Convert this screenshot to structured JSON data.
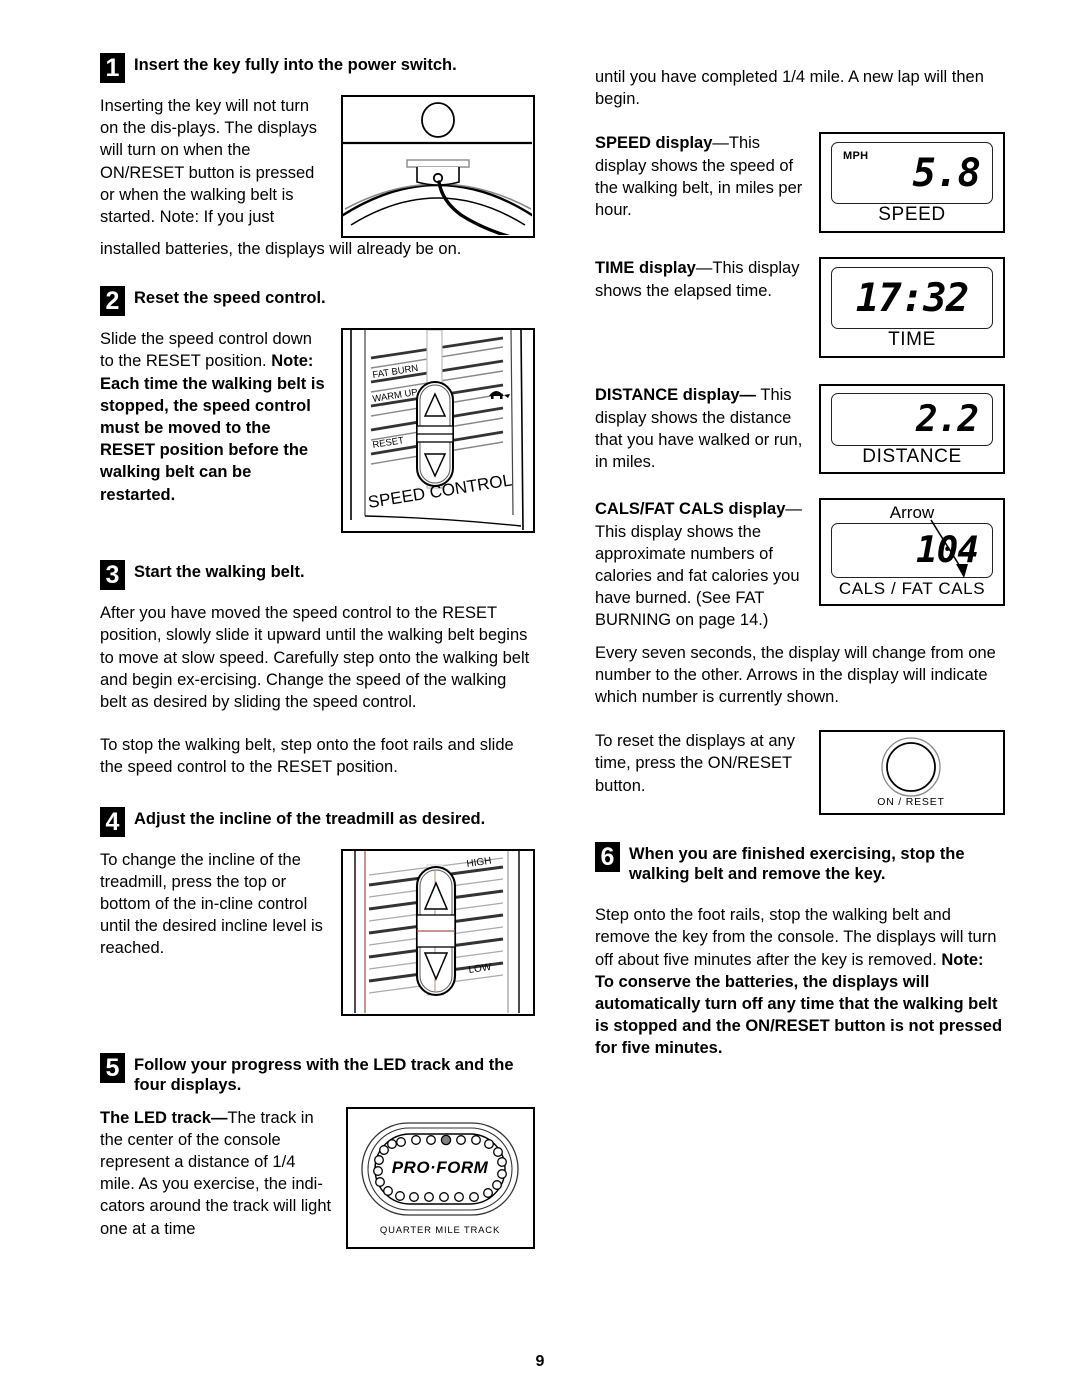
{
  "page": {
    "number": "9"
  },
  "left_column": {
    "step1": {
      "number": "1",
      "title": "Insert the key fully into the power switch.",
      "para_wrapped": "Inserting the key will not turn on the dis-plays. The displays will turn on when the ON/RESET button is pressed or when the walking belt is started. Note: If you just",
      "para_full": "installed batteries, the displays will already be on.",
      "figure_name": "power-switch-key-diagram"
    },
    "step2": {
      "number": "2",
      "title": "Reset the speed control.",
      "para_plain": "Slide the speed control down to the RESET position.",
      "para_bold": "Note: Each time the walking belt is stopped, the speed control must be moved to the RESET position before the walking belt can be restarted.",
      "figure": {
        "name": "speed-control-diagram",
        "labels": [
          "FAT BURN",
          "WARM UP",
          "RESET"
        ],
        "caption": "SPEED CONTROL"
      }
    },
    "step3": {
      "number": "3",
      "title": "Start the walking belt.",
      "para1": "After you have moved the speed control to the RESET position, slowly slide it upward until the walking belt begins to move at slow speed. Carefully step onto the walking belt and begin ex-ercising. Change the speed of the walking belt as desired by sliding the speed control.",
      "para2": "To stop the walking belt, step onto the foot rails and slide the speed control to the RESET position."
    },
    "step4": {
      "number": "4",
      "title": "Adjust the incline of the treadmill as desired.",
      "para": "To change the incline of the treadmill, press the top or bottom of the in-cline control until the desired incline level is reached.",
      "figure": {
        "name": "incline-control-diagram",
        "label_high": "HIGH",
        "label_low": "LOW"
      }
    },
    "step5": {
      "number": "5",
      "title": "Follow your progress with the LED track and the four displays.",
      "para_bold_lead": "The LED track—",
      "para": "The track in the center of the console represent a distance of 1/4 mile. As you exercise, the indi-cators around the track will light one at a time",
      "figure": {
        "name": "led-track-diagram",
        "brand": "PRO·FORM",
        "caption": "QUARTER MILE TRACK"
      }
    }
  },
  "right_column": {
    "continuation": "until you have completed 1/4 mile. A new lap will then begin.",
    "speed": {
      "label_bold": "SPEED display",
      "label_rest": "—This display shows the speed of the walking belt, in miles per hour.",
      "lcd_value": "5.8",
      "lcd_unit": "MPH",
      "lcd_label": "SPEED"
    },
    "time": {
      "label_bold": "TIME display",
      "label_rest": "—This display shows the elapsed time.",
      "lcd_value": "17:32",
      "lcd_label": "TIME"
    },
    "distance": {
      "label_bold": "DISTANCE display—",
      "label_rest": "This display shows the distance that you have walked or run, in miles.",
      "lcd_value": "2.2",
      "lcd_label": "DISTANCE"
    },
    "cals": {
      "label_bold1": "CALS/FAT CALS",
      "label_bold2": "display",
      "label_rest": "—This display shows the approximate numbers of calories and fat calories you have burned. (See FAT BURNING on page 14.)",
      "lcd_value": "104",
      "lcd_label": "CALS / FAT CALS",
      "annotation": "Arrow"
    },
    "para_every_seven": "Every seven seconds, the display will change from one number to the other. Arrows in the display will indicate which number is currently shown.",
    "reset": {
      "para": "To reset the displays at any time, press the ON/RESET button.",
      "figure": {
        "name": "on-reset-button-diagram",
        "caption": "ON / RESET"
      }
    },
    "step6": {
      "number": "6",
      "title": "When you are finished exercising, stop the walking belt and remove the key.",
      "para_plain": "Step onto the foot rails, stop the walking belt and remove the key from the console. The displays will turn off about five minutes after the key is removed.",
      "para_bold": "Note: To conserve the batteries, the displays will automatically turn off any time that the walking belt is stopped and the ON/RESET button is not pressed for five minutes."
    }
  }
}
